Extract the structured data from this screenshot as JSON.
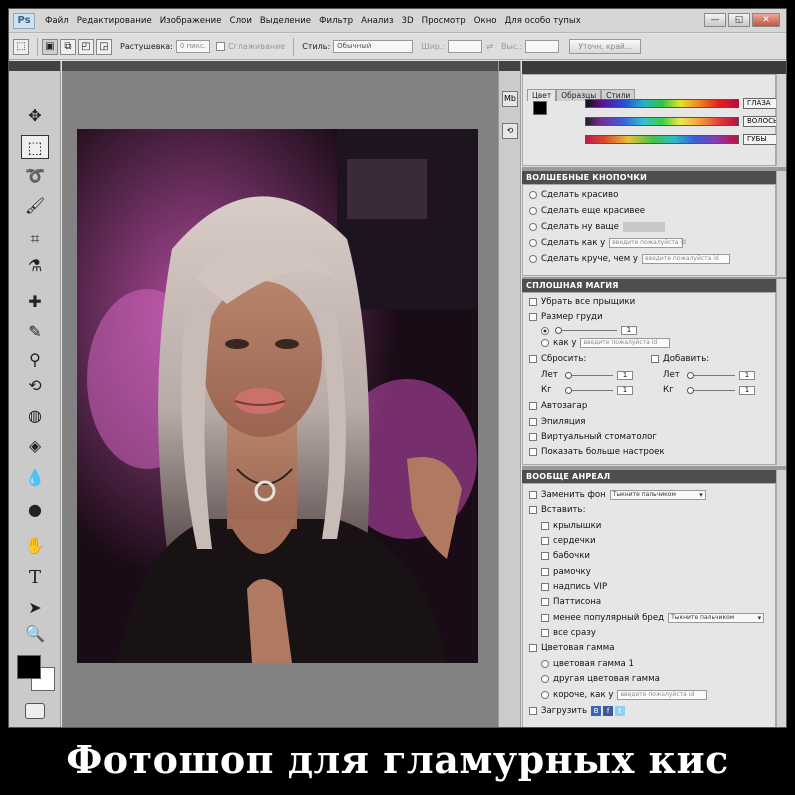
{
  "app": {
    "logo": "Ps"
  },
  "menu": [
    "Файл",
    "Редактирование",
    "Изображение",
    "Слои",
    "Выделение",
    "Фильтр",
    "Анализ",
    "3D",
    "Просмотр",
    "Окно",
    "Для особо тупых"
  ],
  "window_buttons": [
    "—",
    "◱",
    "✕"
  ],
  "options": {
    "feather_label": "Растушевка:",
    "feather_value": "0 пикс.",
    "antialias_label": "Сглаживание",
    "style_label": "Стиль:",
    "style_value": "Обычный",
    "width_label": "Шир.:",
    "height_label": "Выс.:",
    "refine_button": "Уточн. край..."
  },
  "tools": [
    "move-icon",
    "marquee-icon",
    "lasso-icon",
    "quick-select-icon",
    "crop-icon",
    "eyedropper-icon",
    "healing-brush-icon",
    "brush-icon",
    "clone-stamp-icon",
    "history-brush-icon",
    "eraser-icon",
    "gradient-icon",
    "blur-icon",
    "dodge-icon",
    "hand-icon",
    "type-icon",
    "path-select-icon",
    "zoom-icon"
  ],
  "colors": {
    "foreground": "#000000",
    "background": "#ffffff",
    "panel_title_bg": "#4e4e4e"
  },
  "color_panel": {
    "tabs": [
      "Цвет",
      "Образцы",
      "Стили"
    ],
    "gradients": [
      {
        "label": "ГЛАЗА"
      },
      {
        "label": "ВОЛОСЫ"
      },
      {
        "label": "ГУБЫ"
      }
    ]
  },
  "panel_magic_buttons": {
    "title": "ВОЛШЕБНЫЕ КНОПОЧКИ",
    "items": [
      {
        "label": "Сделать красиво"
      },
      {
        "label": "Сделать еще красивее"
      },
      {
        "label": "Сделать ну ваще"
      },
      {
        "label": "Сделать как у",
        "field": "введите пожалуйста id"
      },
      {
        "label": "Сделать круче, чем у",
        "field": "введите пожалуйста id"
      }
    ]
  },
  "panel_solid_magic": {
    "title": "СПЛОШНАЯ МАГИЯ",
    "remove_pimples": "Убрать все прыщики",
    "breast_size": "Размер груди",
    "breast_value": "1",
    "like_label": "как у",
    "like_field": "введите пожалуйста id",
    "reset_label": "Сбросить:",
    "add_label": "Добавить:",
    "years_label": "Лет",
    "kg_label": "Кг",
    "reset_years": "1",
    "reset_kg": "1",
    "add_years": "1",
    "add_kg": "1",
    "items": [
      "Автозагар",
      "Эпиляция",
      "Виртуальный стоматолог",
      "Показать больше настроек"
    ]
  },
  "panel_surreal": {
    "title": "ВООБЩЕ АНРЕАЛ",
    "replace_bg": "Заменить фон",
    "replace_bg_value": "Тыкните пальчиком",
    "insert_label": "Вставить:",
    "insert_items": [
      "крылышки",
      "сердечки",
      "бабочки",
      "рамочку",
      "надпись VIP",
      "Паттисона"
    ],
    "less_popular": "менее популярный бред",
    "less_popular_value": "Тыкните пальчиком",
    "all_at_once": "все сразу",
    "color_gamma": "Цветовая гамма",
    "gamma_items": [
      "цветовая гамма 1",
      "другая цветовая гамма"
    ],
    "short_like": "короче, как у",
    "short_like_field": "введите пожалуйста id",
    "upload": "Загрузить"
  },
  "caption": "Фотошоп для гламурных кис"
}
